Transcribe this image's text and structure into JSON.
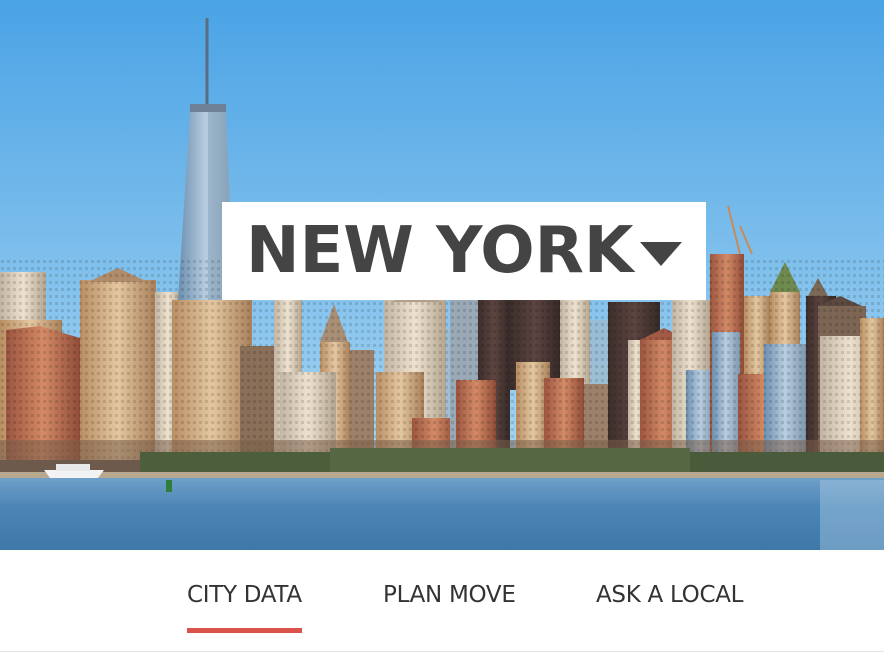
{
  "hero": {
    "city_name": "NEW YORK",
    "dropdown_icon": "caret-down-icon",
    "image_subject": "New York City skyline across the water"
  },
  "nav": {
    "items": [
      {
        "label": "CITY DATA",
        "active": true
      },
      {
        "label": "PLAN MOVE",
        "active": false
      },
      {
        "label": "ASK A LOCAL",
        "active": false
      }
    ],
    "active_color": "#d9534a"
  },
  "colors": {
    "sky_top": "#4fa6e6",
    "sky_bottom": "#a6d5f2",
    "water": "#4f89b8",
    "text": "#444444"
  }
}
